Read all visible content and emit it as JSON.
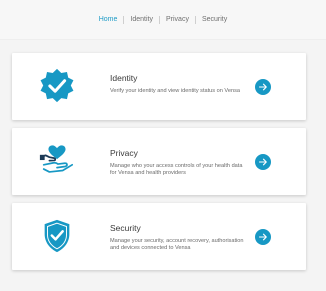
{
  "nav": {
    "items": [
      {
        "label": "Home"
      },
      {
        "label": "Identity"
      },
      {
        "label": "Privacy"
      },
      {
        "label": "Security"
      }
    ],
    "active_color": "#1e9bc6"
  },
  "cards": [
    {
      "title": "Identity",
      "description": "Verify your identity and view identity status on Vensa",
      "icon": "verified-badge-icon"
    },
    {
      "title": "Privacy",
      "description": "Manage who your access controls of your health data for Vensa and health providers",
      "icon": "heart-hand-icon"
    },
    {
      "title": "Security",
      "description": "Manage your security, account recovery, authorisation and devices connected to Vensa",
      "icon": "shield-check-icon"
    }
  ],
  "colors": {
    "accent": "#1798c4",
    "dark_navy": "#1d3b57"
  }
}
